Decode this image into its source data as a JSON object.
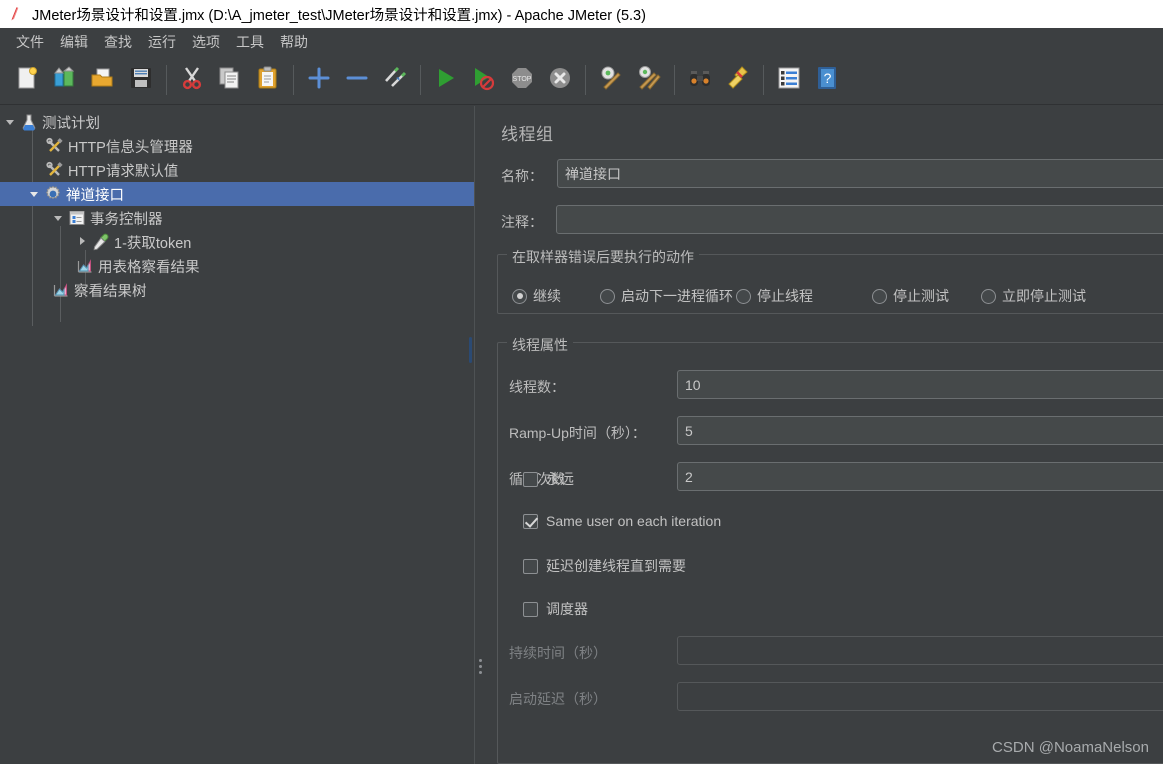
{
  "window": {
    "icon": "jmeter-flask-icon",
    "title": "JMeter场景设计和设置.jmx (D:\\A_jmeter_test\\JMeter场景设计和设置.jmx) - Apache JMeter (5.3)"
  },
  "menubar": {
    "items": [
      {
        "label": "文件",
        "name": "menu-file"
      },
      {
        "label": "编辑",
        "name": "menu-edit"
      },
      {
        "label": "查找",
        "name": "menu-search"
      },
      {
        "label": "运行",
        "name": "menu-run"
      },
      {
        "label": "选项",
        "name": "menu-options"
      },
      {
        "label": "工具",
        "name": "menu-tools"
      },
      {
        "label": "帮助",
        "name": "menu-help"
      }
    ]
  },
  "toolbar": {
    "buttons": [
      {
        "icon": "new-document-icon",
        "name": "toolbar-new"
      },
      {
        "icon": "templates-icon",
        "name": "toolbar-templates"
      },
      {
        "icon": "open-folder-icon",
        "name": "toolbar-open"
      },
      {
        "icon": "save-icon",
        "name": "toolbar-save"
      },
      {
        "icon": "cut-scissors-icon",
        "name": "toolbar-cut"
      },
      {
        "icon": "copy-icon",
        "name": "toolbar-copy"
      },
      {
        "icon": "paste-clipboard-icon",
        "name": "toolbar-paste"
      },
      {
        "icon": "plus-icon",
        "name": "toolbar-expand-all"
      },
      {
        "icon": "minus-icon",
        "name": "toolbar-collapse-all"
      },
      {
        "icon": "toggle-pencils-icon",
        "name": "toolbar-toggle"
      },
      {
        "icon": "start-play-icon",
        "name": "toolbar-start"
      },
      {
        "icon": "start-no-timers-icon",
        "name": "toolbar-start-no-pauses"
      },
      {
        "icon": "stop-icon",
        "name": "toolbar-stop"
      },
      {
        "icon": "shutdown-icon",
        "name": "toolbar-shutdown"
      },
      {
        "icon": "clear-icon",
        "name": "toolbar-clear"
      },
      {
        "icon": "clear-all-icon",
        "name": "toolbar-clear-all"
      },
      {
        "icon": "search-binoculars-icon",
        "name": "toolbar-search"
      },
      {
        "icon": "reset-search-broom-icon",
        "name": "toolbar-reset-search"
      },
      {
        "icon": "function-helper-icon",
        "name": "toolbar-function-helper"
      },
      {
        "icon": "help-book-icon",
        "name": "toolbar-help"
      }
    ]
  },
  "tree": {
    "nodes": [
      {
        "label": "测试计划",
        "icon": "flask-icon",
        "depth": 0,
        "twisty": "down",
        "selected": false,
        "name": "tree-node-test-plan"
      },
      {
        "label": "HTTP信息头管理器",
        "icon": "config-tools-icon",
        "depth": 1,
        "twisty": "none",
        "selected": false,
        "name": "tree-node-http-header-manager"
      },
      {
        "label": "HTTP请求默认值",
        "icon": "config-tools-icon",
        "depth": 1,
        "twisty": "none",
        "selected": false,
        "name": "tree-node-http-request-defaults"
      },
      {
        "label": "禅道接口",
        "icon": "gear-icon",
        "depth": 1,
        "twisty": "down",
        "selected": true,
        "name": "tree-node-thread-group"
      },
      {
        "label": "事务控制器",
        "icon": "controller-icon",
        "depth": 2,
        "twisty": "down",
        "selected": false,
        "name": "tree-node-transaction-controller"
      },
      {
        "label": "1-获取token",
        "icon": "sampler-icon",
        "depth": 3,
        "twisty": "right",
        "selected": false,
        "name": "tree-node-sampler-get-token"
      },
      {
        "label": "用表格察看结果",
        "icon": "listener-icon",
        "depth": 3,
        "twisty": "none",
        "selected": false,
        "name": "tree-node-view-results-in-table"
      },
      {
        "label": "察看结果树",
        "icon": "listener-icon",
        "depth": 2,
        "twisty": "none",
        "selected": false,
        "name": "tree-node-view-results-tree"
      }
    ]
  },
  "detail": {
    "panel_title": "线程组",
    "name_label": "名称：",
    "name_value": "禅道接口",
    "comments_label": "注释：",
    "comments_value": "",
    "on_error_group_title": "在取样器错误后要执行的动作",
    "on_error_options": [
      {
        "label": "继续",
        "selected": true,
        "name": "radio-continue"
      },
      {
        "label": "启动下一进程循环",
        "selected": false,
        "name": "radio-start-next-loop"
      },
      {
        "label": "停止线程",
        "selected": false,
        "name": "radio-stop-thread"
      },
      {
        "label": "停止测试",
        "selected": false,
        "name": "radio-stop-test"
      },
      {
        "label": "立即停止测试",
        "selected": false,
        "name": "radio-stop-test-now"
      }
    ],
    "thread_props_group_title": "线程属性",
    "num_threads_label": "线程数：",
    "num_threads_value": "10",
    "ramp_up_label": "Ramp-Up时间（秒）：",
    "ramp_up_value": "5",
    "loop_count_label": "循环次数",
    "forever_label": "永远",
    "forever_checked": false,
    "loop_count_value": "2",
    "same_user_label": "Same user on each iteration",
    "same_user_checked": true,
    "delayed_start_label": "延迟创建线程直到需要",
    "delayed_start_checked": false,
    "scheduler_label": "调度器",
    "scheduler_checked": false,
    "duration_label": "持续时间（秒）",
    "duration_value": "",
    "startup_delay_label": "启动延迟（秒）",
    "startup_delay_value": "",
    "watermark": "CSDN @NoamaNelson"
  },
  "colors": {
    "background": "#3c3f41",
    "selection": "#4a6cac",
    "field_background": "#45494a",
    "titlebar": "#ffffff"
  }
}
